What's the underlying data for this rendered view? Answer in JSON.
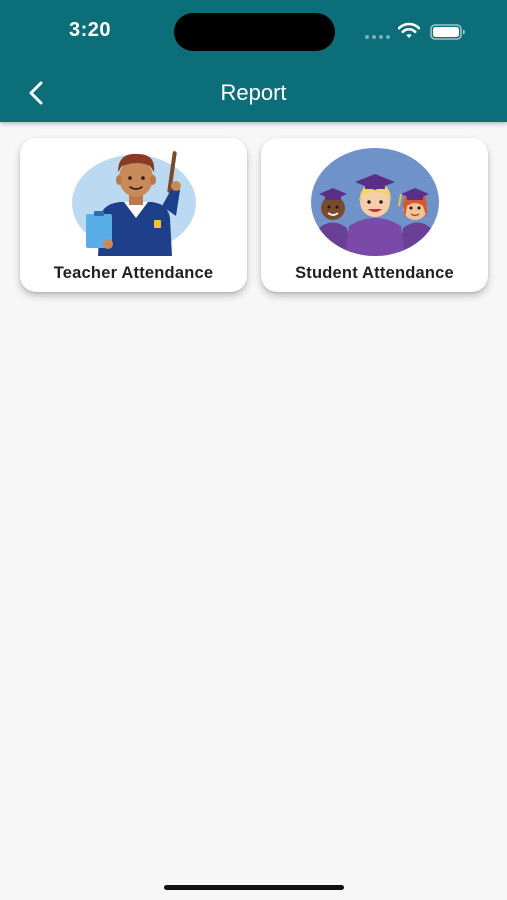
{
  "status_bar": {
    "time": "3:20",
    "icons": [
      "cellular-signal-icon",
      "wifi-icon",
      "battery-icon"
    ]
  },
  "header": {
    "title": "Report",
    "back_icon": "chevron-left-icon",
    "background_color": "#0c6e78"
  },
  "cards": [
    {
      "label": "Teacher Attendance",
      "illustration": "teacher-illustration"
    },
    {
      "label": "Student Attendance",
      "illustration": "graduates-illustration"
    }
  ],
  "colors": {
    "accent": "#0c6e78",
    "page_background": "#f7f7f7",
    "card_background": "#ffffff"
  }
}
